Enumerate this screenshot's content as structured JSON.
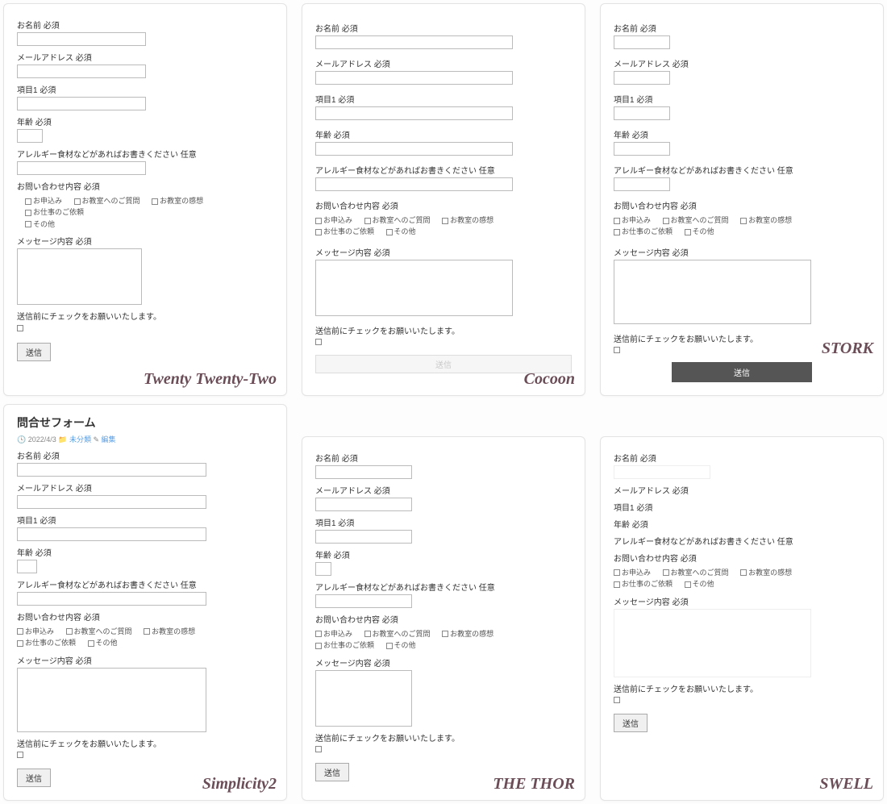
{
  "labels": {
    "name": "お名前 必須",
    "email": "メールアドレス 必須",
    "item1": "項目1 必須",
    "age": "年齢 必須",
    "allergy": "アレルギー食材などがあればお書きください 任意",
    "inquiry": "お問い合わせ内容 必須",
    "message": "メッセージ内容 必須",
    "confirm": "送信前にチェックをお願いいたします。",
    "submit": "送信"
  },
  "options": {
    "o1": "お申込み",
    "o2": "お教室へのご質問",
    "o3": "お教室の感想",
    "o4": "お仕事のご依頼",
    "o5": "その他"
  },
  "simplicity": {
    "title": "問合せフォーム",
    "date": "2022/4/3",
    "category": "未分類",
    "edit": "編集"
  },
  "themes": {
    "t1": "Twenty Twenty-Two",
    "t2": "Cocoon",
    "t3": "STORK",
    "t4": "Simplicity2",
    "t5": "THE THOR",
    "t6": "SWELL"
  }
}
